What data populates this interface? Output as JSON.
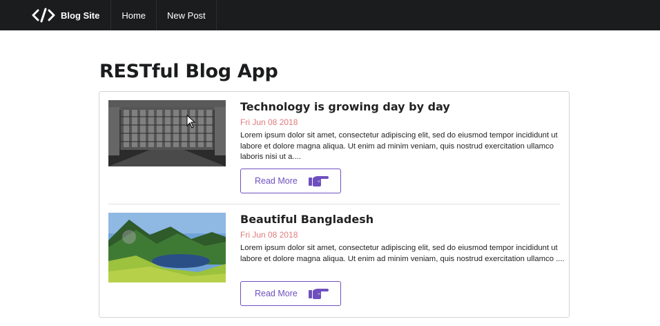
{
  "navbar": {
    "brand_label": "Blog Site",
    "brand_icon": "code-icon",
    "items": [
      {
        "label": "Home"
      },
      {
        "label": "New Post"
      }
    ]
  },
  "page": {
    "title": "RESTful Blog App"
  },
  "posts": [
    {
      "title": "Technology is growing day by day",
      "date": "Fri Jun 08 2018",
      "excerpt": "Lorem ipsum dolor sit amet, consectetur adipiscing elit, sed do eiusmod tempor incididunt ut labore et dolore magna aliqua. Ut enim ad minim veniam, quis nostrud exercitation ullamco laboris nisi ut a....",
      "read_more_label": "Read More",
      "image": "server-room-photo"
    },
    {
      "title": "Beautiful Bangladesh",
      "date": "Fri Jun 08 2018",
      "excerpt": "Lorem ipsum dolor sit amet, consectetur adipiscing elit, sed do eiusmod tempor incididunt ut labore et dolore magna aliqua. Ut enim ad minim veniam, quis nostrud exercitation ullamco ....",
      "read_more_label": "Read More",
      "image": "landscape-photo"
    }
  ],
  "colors": {
    "navbar_bg": "#1b1c1d",
    "accent": "#6f4fbf",
    "date": "#e07b7b"
  },
  "icons": {
    "read_more_icon": "hand-pointing-right-icon"
  }
}
